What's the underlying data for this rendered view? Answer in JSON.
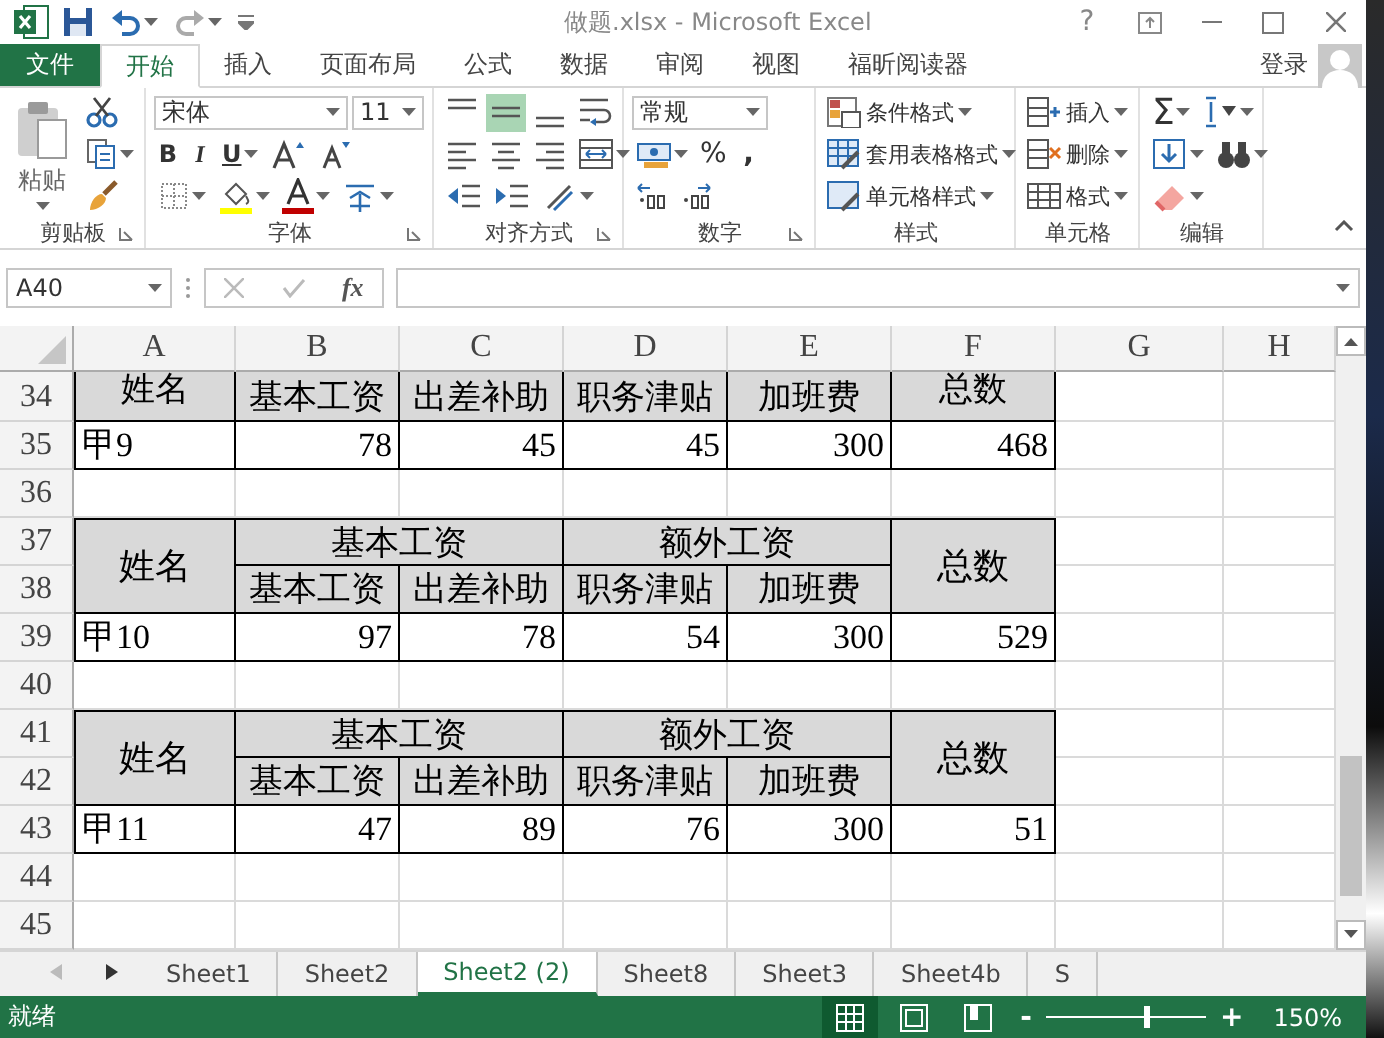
{
  "window": {
    "title": "做题.xlsx - Microsoft Excel",
    "help": "?"
  },
  "ribbon_tabs": [
    {
      "label": "文件",
      "kind": "file",
      "selected": false
    },
    {
      "label": "开始",
      "kind": "tab",
      "selected": true
    },
    {
      "label": "插入",
      "kind": "tab",
      "selected": false
    },
    {
      "label": "页面布局",
      "kind": "tab",
      "selected": false
    },
    {
      "label": "公式",
      "kind": "tab",
      "selected": false
    },
    {
      "label": "数据",
      "kind": "tab",
      "selected": false
    },
    {
      "label": "审阅",
      "kind": "tab",
      "selected": false
    },
    {
      "label": "视图",
      "kind": "tab",
      "selected": false
    },
    {
      "label": "福昕阅读器",
      "kind": "tab",
      "selected": false
    }
  ],
  "account": {
    "label": "登录"
  },
  "ribbon_groups": [
    {
      "kind": "clipboard",
      "label": "剪贴板",
      "paste": "粘贴"
    },
    {
      "kind": "font",
      "label": "字体",
      "font_name": "宋体",
      "font_size": "11",
      "bold": "B",
      "italic": "I",
      "underline": "U"
    },
    {
      "kind": "alignment",
      "label": "对齐方式",
      "vertical_align": [
        {
          "selected": false
        },
        {
          "selected": true
        },
        {
          "selected": false
        }
      ]
    },
    {
      "kind": "number",
      "label": "数字",
      "format": "常规",
      "percent": "%",
      "comma": ","
    },
    {
      "kind": "styles",
      "label": "样式",
      "commands": [
        "条件格式",
        "套用表格格式",
        "单元格样式"
      ]
    },
    {
      "kind": "cells",
      "label": "单元格",
      "commands": [
        "插入",
        "删除",
        "格式"
      ]
    },
    {
      "kind": "editing",
      "label": "编辑",
      "autosum": "Σ"
    }
  ],
  "formula_bar": {
    "name_box": "A40",
    "function_label": "fx"
  },
  "sheet": {
    "columns": [
      "A",
      "B",
      "C",
      "D",
      "E",
      "F",
      "G",
      "H"
    ],
    "rows": [
      {
        "number": "34",
        "kind": "header_cut",
        "cells": [
          "姓名",
          "基本工资",
          "出差补助",
          "职务津贴",
          "加班费",
          "总数"
        ]
      },
      {
        "number": "35",
        "kind": "data",
        "cells": [
          "甲9",
          "78",
          "45",
          "45",
          "300",
          "468"
        ]
      },
      {
        "number": "36",
        "kind": "blank"
      },
      {
        "number": "37",
        "kind": "header_top",
        "cells": [
          "姓名",
          "基本工资",
          "额外工资",
          "总数"
        ]
      },
      {
        "number": "38",
        "kind": "header_bottom",
        "cells": [
          "基本工资",
          "出差补助",
          "职务津贴",
          "加班费"
        ]
      },
      {
        "number": "39",
        "kind": "data",
        "cells": [
          "甲10",
          "97",
          "78",
          "54",
          "300",
          "529"
        ]
      },
      {
        "number": "40",
        "kind": "blank"
      },
      {
        "number": "41",
        "kind": "header_top",
        "cells": [
          "姓名",
          "基本工资",
          "额外工资",
          "总数"
        ]
      },
      {
        "number": "42",
        "kind": "header_bottom",
        "cells": [
          "基本工资",
          "出差补助",
          "职务津贴",
          "加班费"
        ]
      },
      {
        "number": "43",
        "kind": "data",
        "cells": [
          "甲11",
          "47",
          "89",
          "76",
          "300",
          "51"
        ]
      },
      {
        "number": "44",
        "kind": "blank"
      },
      {
        "number": "45",
        "kind": "blank"
      }
    ]
  },
  "sheet_tabs": [
    {
      "label": "Sheet1",
      "selected": false
    },
    {
      "label": "Sheet2",
      "selected": false
    },
    {
      "label": "Sheet2  (2)",
      "selected": true
    },
    {
      "label": "Sheet8",
      "selected": false
    },
    {
      "label": "Sheet3",
      "selected": false
    },
    {
      "label": "Sheet4b",
      "selected": false
    },
    {
      "label": "S",
      "selected": false
    }
  ],
  "status_bar": {
    "status": "就绪",
    "views": [
      {
        "selected": true
      },
      {
        "selected": false
      },
      {
        "selected": false
      }
    ],
    "minus": "-",
    "plus": "+",
    "zoom": {
      "level": 0.62,
      "reading": "150%"
    }
  }
}
